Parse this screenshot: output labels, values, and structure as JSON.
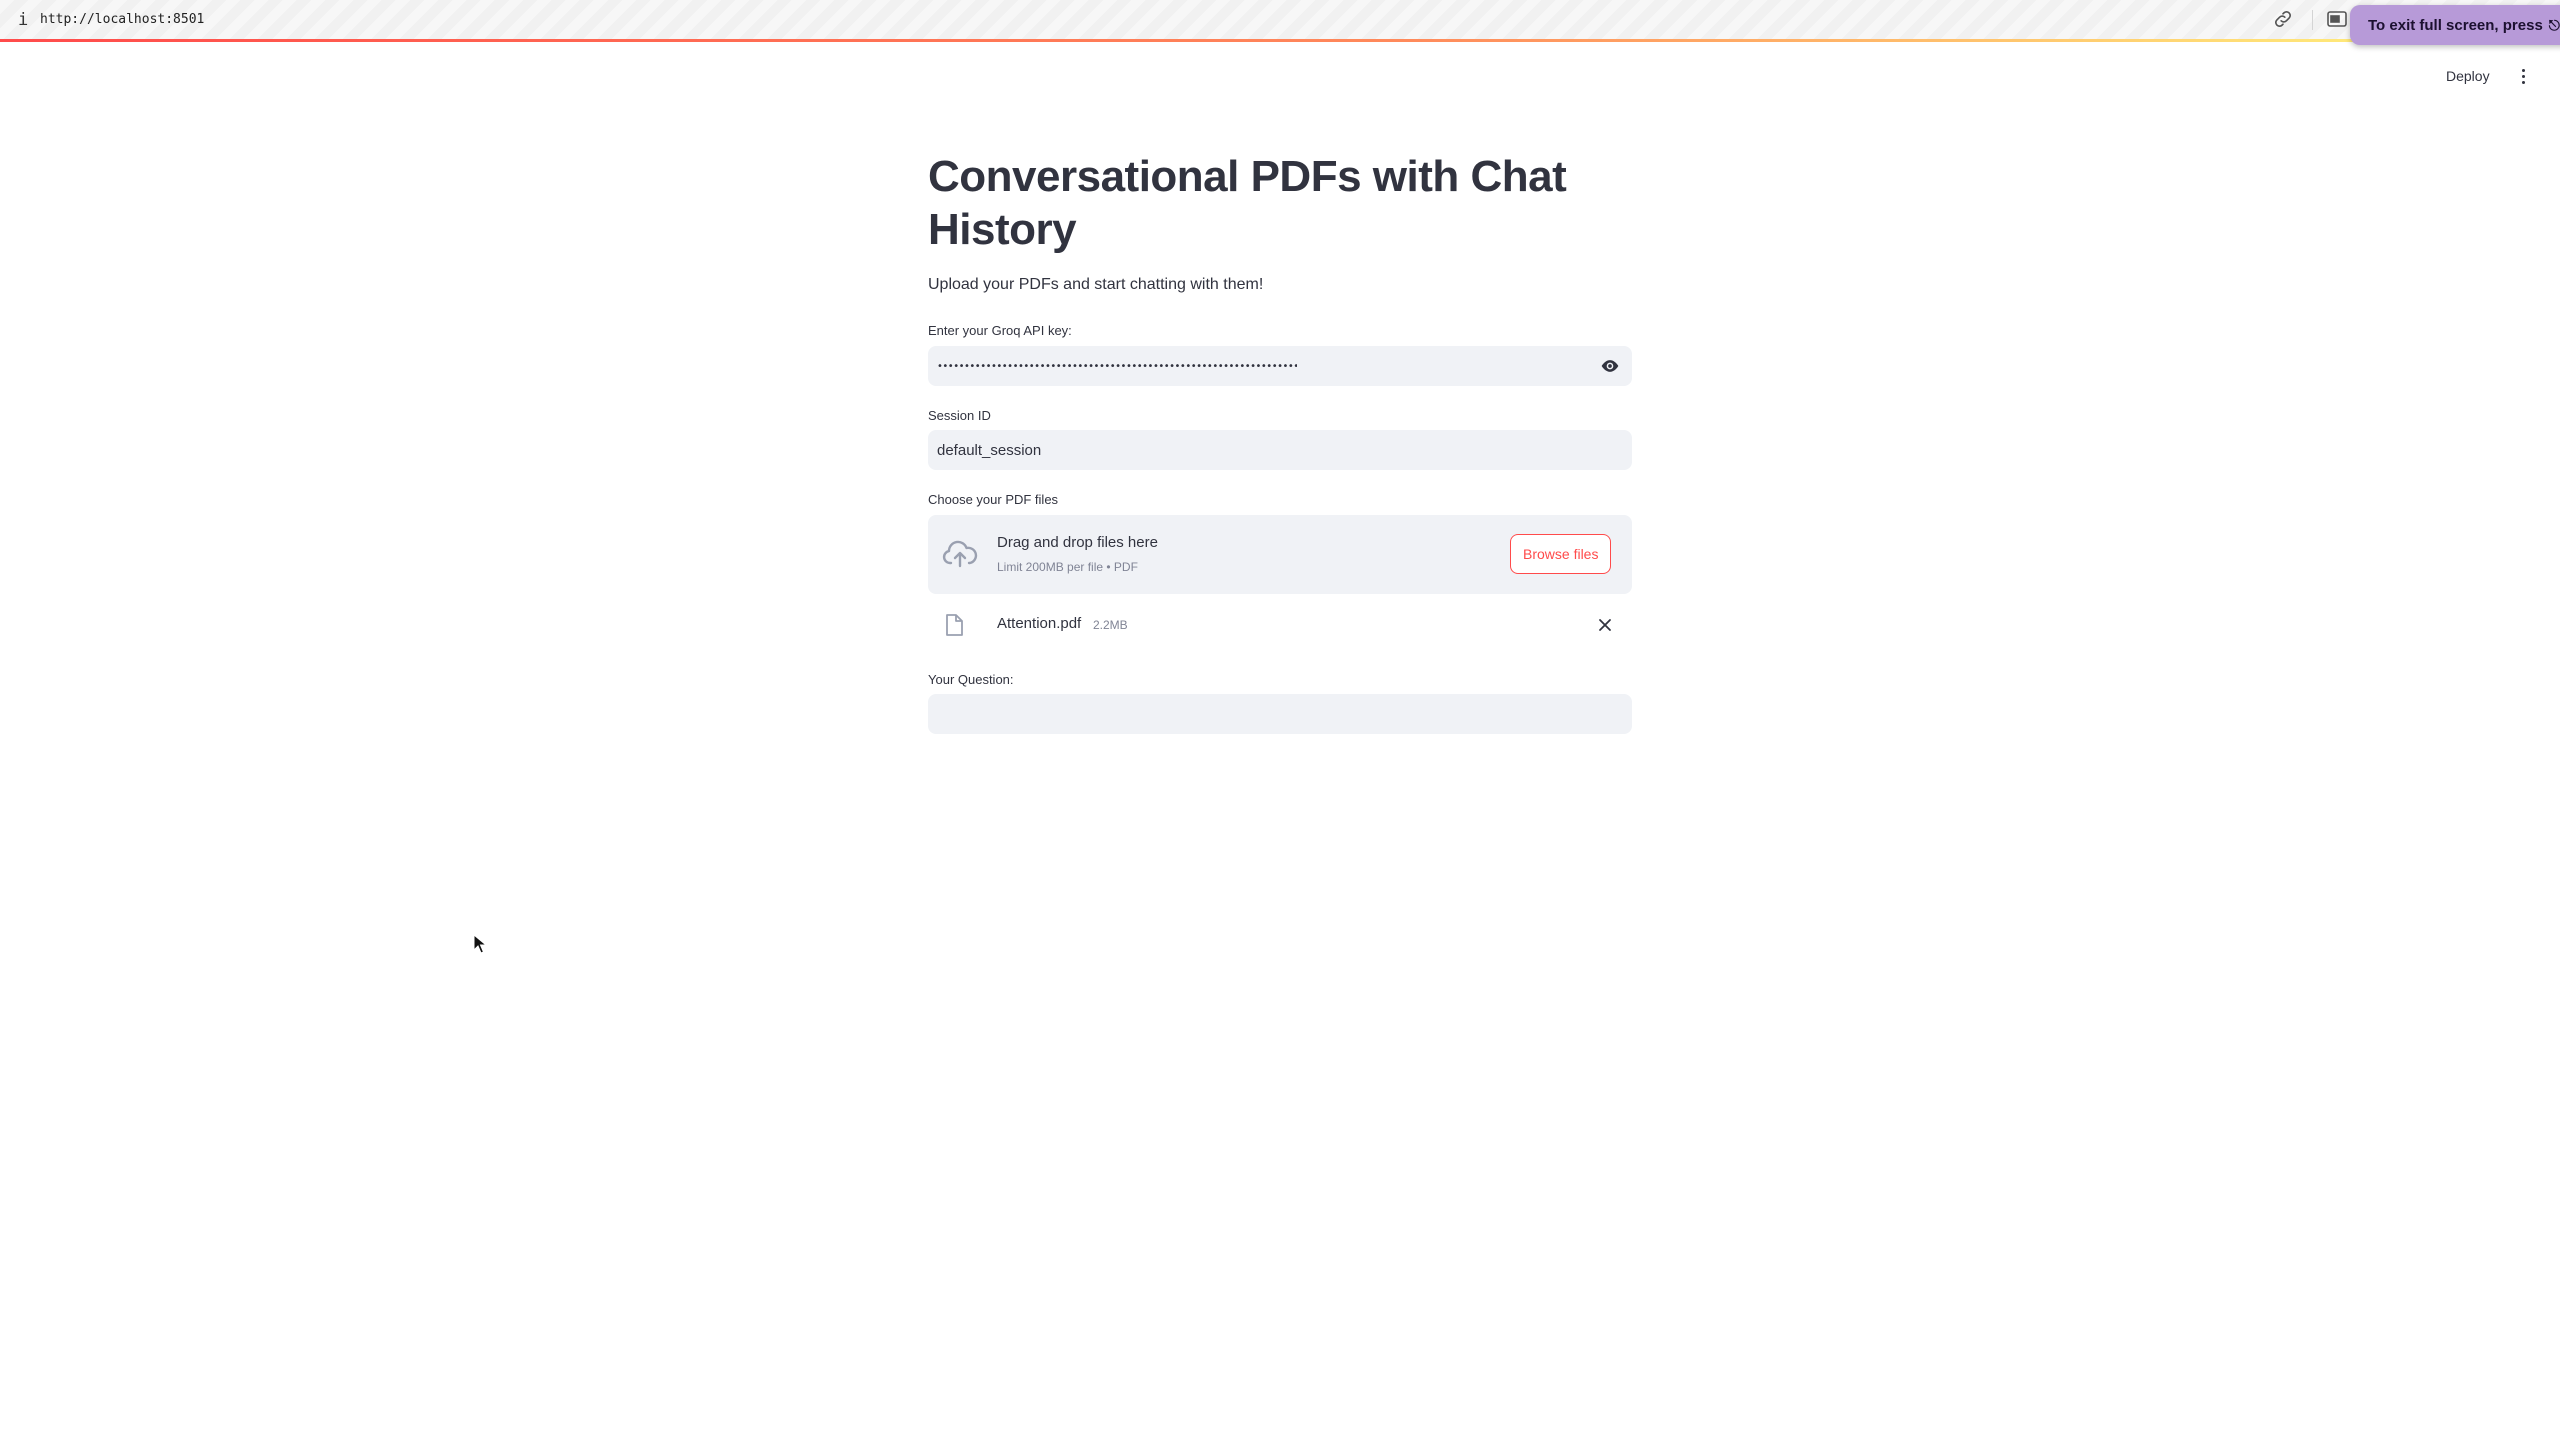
{
  "browser": {
    "info_glyph": "i",
    "url": "http://localhost:8501",
    "fullscreen_toast": "To exit full screen, press",
    "toast_glyph": "⎋."
  },
  "header": {
    "deploy_label": "Deploy"
  },
  "main": {
    "title": "Conversational PDFs with Chat History",
    "subtitle": "Upload your PDFs and start chatting with them!",
    "api_key": {
      "label": "Enter your Groq API key:",
      "masked_value": "••••••••••••••••••••••••••••••••••••••••••••••••••••••••••••••••••••••••••••••••••••••••••••••"
    },
    "session": {
      "label": "Session ID",
      "value": "default_session"
    },
    "uploader": {
      "label": "Choose your PDF files",
      "drop_text": "Drag and drop files here",
      "limit_text": "Limit 200MB per file • PDF",
      "browse_label": "Browse files"
    },
    "uploaded_file": {
      "name": "Attention.pdf",
      "size": "2.2MB"
    },
    "question": {
      "label": "Your Question:",
      "value": ""
    }
  },
  "colors": {
    "primary": "#ff4b4b",
    "text": "#31333f",
    "input_bg": "#f0f2f6",
    "muted": "#808495",
    "toast_bg": "#b79ad8"
  }
}
